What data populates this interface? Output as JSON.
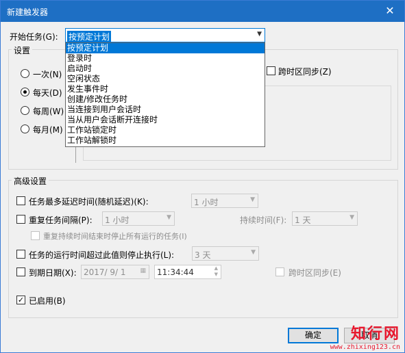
{
  "window": {
    "title": "新建触发器",
    "close": "✕"
  },
  "start_task": {
    "label": "开始任务(G):",
    "value": "按预定计划",
    "options": [
      "按预定计划",
      "登录时",
      "启动时",
      "空闲状态",
      "发生事件时",
      "创建/修改任务时",
      "当连接到用户会话时",
      "当从用户会话断开连接时",
      "工作站锁定时",
      "工作站解锁时"
    ]
  },
  "settings": {
    "legend": "设置",
    "once": "一次(N)",
    "daily": "每天(D)",
    "weekly": "每周(W)",
    "monthly": "每月(M)",
    "sync_tz": "跨时区同步(Z)"
  },
  "advanced": {
    "legend": "高级设置",
    "delay_label": "任务最多延迟时间(随机延迟)(K):",
    "delay_value": "1 小时",
    "repeat_label": "重复任务间隔(P):",
    "repeat_value": "1 小时",
    "duration_label": "持续时间(F):",
    "duration_value": "1 天",
    "stop_all_label": "重复持续时间结束时停止所有运行的任务(I)",
    "stop_if_label": "任务的运行时间超过此值则停止执行(L):",
    "stop_if_value": "3 天",
    "expire_label": "到期日期(X):",
    "expire_date": "2017/ 9/ 1",
    "expire_time": "11:34:44",
    "expire_sync_tz": "跨时区同步(E)",
    "enabled_label": "已启用(B)"
  },
  "buttons": {
    "ok": "确定",
    "cancel": "取消"
  },
  "watermark": {
    "brand": "知行网",
    "url": "www.zhixing123.cn"
  }
}
